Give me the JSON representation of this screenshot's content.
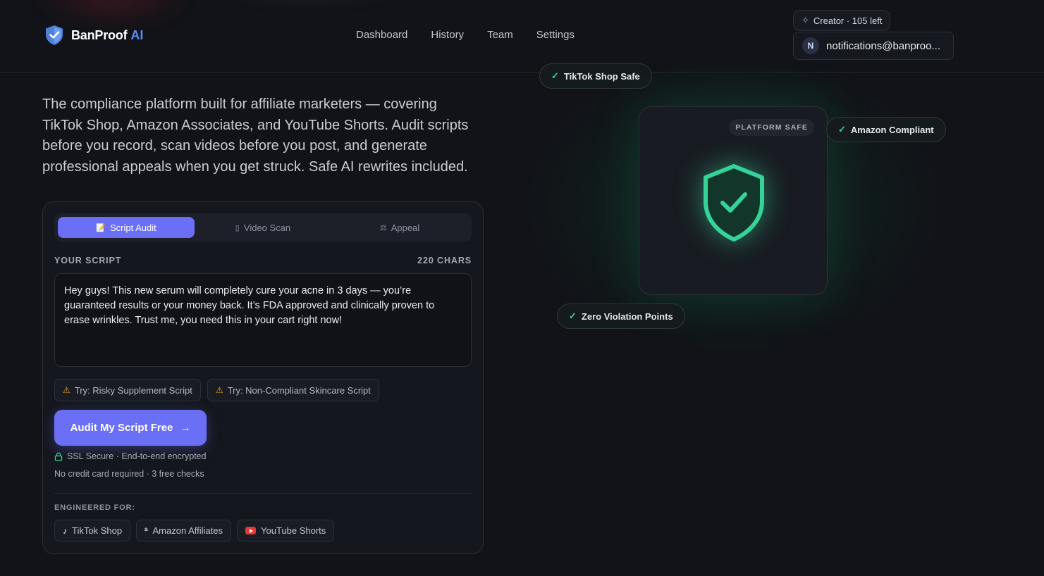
{
  "brand": {
    "name": "BanProof",
    "suffix": "AI"
  },
  "nav": [
    {
      "label": "Dashboard"
    },
    {
      "label": "History"
    },
    {
      "label": "Team"
    },
    {
      "label": "Settings"
    }
  ],
  "plan": {
    "label": "Creator · 105 left",
    "icon": "sparkle-icon"
  },
  "account": {
    "initial": "N",
    "email": "notifications@banproo..."
  },
  "hero": {
    "description": "The compliance platform built for affiliate marketers — covering TikTok Shop, Amazon Associates, and YouTube Shorts. Audit scripts before you record, scan videos before you post, and generate professional appeals when you get struck. Safe AI rewrites included."
  },
  "card": {
    "tabs": [
      {
        "label": "Script Audit",
        "icon": "document-icon",
        "active": true
      },
      {
        "label": "Video Scan",
        "icon": "video-icon",
        "active": false
      },
      {
        "label": "Appeal",
        "icon": "scale-icon",
        "active": false
      }
    ],
    "script_label": "YOUR SCRIPT",
    "char_count": "220 CHARS",
    "script_text": "Hey guys! This new serum will completely cure your acne in 3 days — you’re guaranteed results or your money back. It’s FDA approved and clinically proven to erase wrinkles. Trust me, you need this in your cart right now!",
    "try_chips": [
      {
        "label": "Try: Risky Supplement Script",
        "icon": "warning-icon"
      },
      {
        "label": "Try: Non-Compliant Skincare Script",
        "icon": "warning-icon"
      }
    ],
    "cta": "Audit My Script Free",
    "ssl_note": "SSL Secure · End-to-end encrypted",
    "no_card_note": "No credit card required · 3 free checks",
    "engineered_label": "ENGINEERED FOR:",
    "platforms": [
      {
        "label": "TikTok Shop",
        "icon": "tiktok-icon"
      },
      {
        "label": "Amazon Affiliates",
        "icon": "amazon-icon"
      },
      {
        "label": "YouTube Shorts",
        "icon": "youtube-icon"
      }
    ]
  },
  "visual": {
    "badges": [
      {
        "label": "TikTok Shop Safe"
      },
      {
        "label": "Amazon Compliant"
      },
      {
        "label": "Zero Violation Points"
      }
    ],
    "tag": "PLATFORM SAFE"
  },
  "colors": {
    "accent": "#6a6ff5",
    "success": "#34d399",
    "background": "#111318",
    "brand_ai": "#5b8def"
  }
}
